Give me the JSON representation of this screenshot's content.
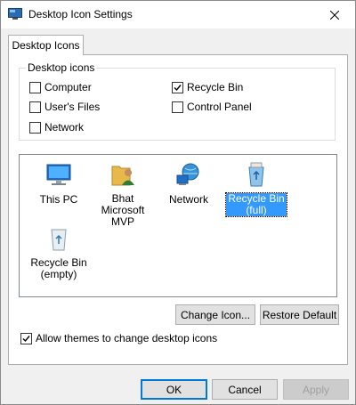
{
  "window": {
    "title": "Desktop Icon Settings"
  },
  "tabs": [
    {
      "label": "Desktop Icons"
    }
  ],
  "group": {
    "legend": "Desktop icons",
    "checkboxes": [
      {
        "label": "Computer",
        "checked": false
      },
      {
        "label": "User's Files",
        "checked": false
      },
      {
        "label": "Network",
        "checked": false
      },
      {
        "label": "Recycle Bin",
        "checked": true
      },
      {
        "label": "Control Panel",
        "checked": false
      }
    ]
  },
  "icons": [
    {
      "line1": "This PC",
      "line2": "",
      "icon": "monitor-icon",
      "selected": false
    },
    {
      "line1": "Bhat Microsoft",
      "line2": "MVP",
      "icon": "user-folder-icon",
      "selected": false
    },
    {
      "line1": "Network",
      "line2": "",
      "icon": "network-globe-icon",
      "selected": false
    },
    {
      "line1": "Recycle Bin",
      "line2": "(full)",
      "icon": "recycle-bin-full-icon",
      "selected": true
    },
    {
      "line1": "Recycle Bin",
      "line2": "(empty)",
      "icon": "recycle-bin-empty-icon",
      "selected": false
    }
  ],
  "buttons": {
    "change_icon": "Change Icon...",
    "restore_default": "Restore Default",
    "ok": "OK",
    "cancel": "Cancel",
    "apply": "Apply"
  },
  "allow_themes": {
    "label": "Allow themes to change desktop icons",
    "checked": true
  },
  "colors": {
    "selection": "#3399ff",
    "accent": "#0078d7"
  }
}
